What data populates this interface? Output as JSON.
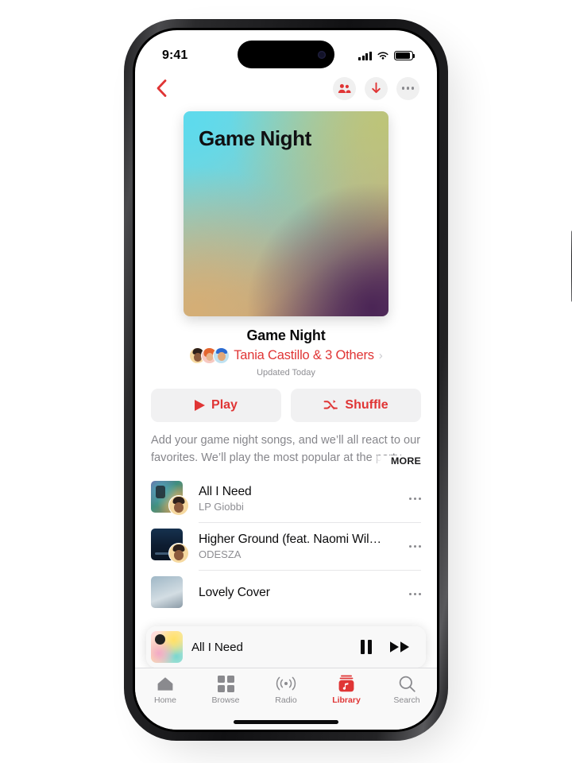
{
  "statusbar": {
    "time": "9:41",
    "signal_icon": "cellular-bars-icon",
    "wifi_icon": "wifi-icon",
    "battery_icon": "battery-icon"
  },
  "navbar": {
    "back_icon": "back-chevron-icon",
    "actions": [
      {
        "name": "collaborate-button",
        "icon": "people-icon",
        "color": "#e03535"
      },
      {
        "name": "download-button",
        "icon": "download-arrow-icon",
        "color": "#e03535"
      },
      {
        "name": "more-button",
        "icon": "ellipsis-icon",
        "color": "#8a8a8e"
      }
    ]
  },
  "artwork": {
    "title": "Game Night",
    "gradient_colors": [
      "#72d9e6",
      "#bec476",
      "#6a4a6e",
      "#d6ae74"
    ]
  },
  "playlist": {
    "title": "Game Night",
    "owner": "Tania Castillo & 3 Others",
    "owner_color": "#e03535",
    "chevron": "›",
    "updated": "Updated Today",
    "description": "Add your game night songs, and we’ll all react to our favorites. We’ll play the most popular at the party.",
    "more_label": "MORE"
  },
  "actions": {
    "play_label": "Play",
    "play_icon": "play-triangle-icon",
    "shuffle_label": "Shuffle",
    "shuffle_icon": "shuffle-icon",
    "accent": "#e03535"
  },
  "songs": [
    {
      "title": "All I Need",
      "artist": "LP Giobbi",
      "more_icon": "ellipsis-icon"
    },
    {
      "title": "Higher Ground (feat. Naomi Wil…",
      "artist": "ODESZA",
      "more_icon": "ellipsis-icon"
    },
    {
      "title": "Lovely Cover",
      "artist": "",
      "more_icon": "ellipsis-icon"
    }
  ],
  "now_playing": {
    "title": "All I Need",
    "pause_icon": "pause-icon",
    "forward_icon": "fast-forward-icon"
  },
  "tabbar": {
    "active": "Library",
    "tabs": [
      {
        "label": "Home",
        "icon": "home-icon"
      },
      {
        "label": "Browse",
        "icon": "grid-icon"
      },
      {
        "label": "Radio",
        "icon": "radio-waves-icon"
      },
      {
        "label": "Library",
        "icon": "library-icon"
      },
      {
        "label": "Search",
        "icon": "search-icon"
      }
    ]
  }
}
